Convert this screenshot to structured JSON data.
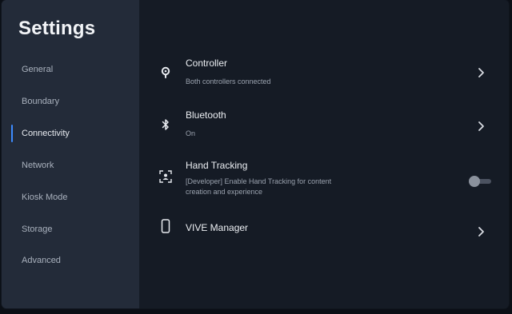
{
  "sidebar": {
    "title": "Settings",
    "items": [
      {
        "label": "General"
      },
      {
        "label": "Boundary"
      },
      {
        "label": "Connectivity",
        "active": true
      },
      {
        "label": "Network"
      },
      {
        "label": "Kiosk Mode"
      },
      {
        "label": "Storage"
      },
      {
        "label": "Advanced"
      }
    ]
  },
  "main": {
    "rows": [
      {
        "title": "Controller",
        "subtitle": "Both controllers connected",
        "icon": "controller-icon",
        "control": "chevron-right-icon"
      },
      {
        "title": "Bluetooth",
        "subtitle": "On",
        "icon": "bluetooth-icon",
        "control": "chevron-right-icon"
      },
      {
        "title": "Hand Tracking",
        "subtitle": "[Developer] Enable Hand Tracking for content creation and experience",
        "icon": "hand-tracking-icon",
        "control": "toggle",
        "toggle_on": false
      },
      {
        "title": "VIVE Manager",
        "subtitle": "",
        "icon": "phone-icon",
        "control": "chevron-right-icon"
      }
    ]
  },
  "colors": {
    "sidebar_bg": "#232b39",
    "main_bg": "#151b25",
    "accent": "#3d8bff",
    "text_primary": "#eceff3",
    "text_secondary": "#9aa2ae"
  }
}
